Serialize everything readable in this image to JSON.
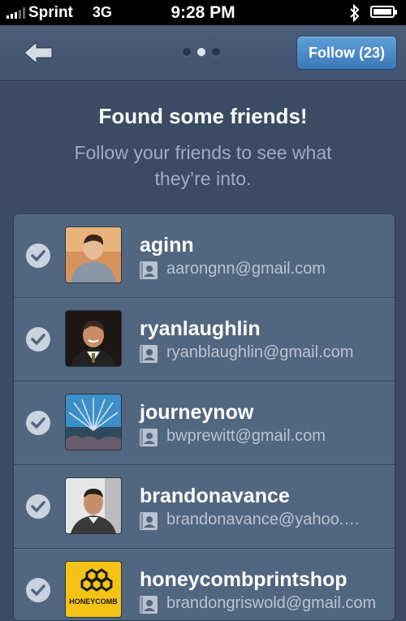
{
  "status_bar": {
    "carrier": "Sprint",
    "network": "3G",
    "time": "9:28 PM"
  },
  "nav": {
    "follow_label": "Follow (23)",
    "pager_total": 3,
    "pager_active": 2
  },
  "heading": {
    "title": "Found some friends!",
    "subtitle": "Follow your friends to see what they’re into."
  },
  "friends": [
    {
      "username": "aginn",
      "email": "aarongnn@gmail.com",
      "checked": true
    },
    {
      "username": "ryanlaughlin",
      "email": "ryanblaughlin@gmail.com",
      "checked": true
    },
    {
      "username": "journeynow",
      "email": "bwprewitt@gmail.com",
      "checked": true
    },
    {
      "username": "brandonavance",
      "email": "brandonavance@yahoo.…",
      "checked": true
    },
    {
      "username": "honeycombprintshop",
      "email": "brandongriswold@gmail.com",
      "checked": true,
      "avatar_text": "HONEYCOMB"
    }
  ],
  "colors": {
    "background": "#3a4b63",
    "follow_button": "#4a8ac8",
    "row": "#51667f"
  }
}
